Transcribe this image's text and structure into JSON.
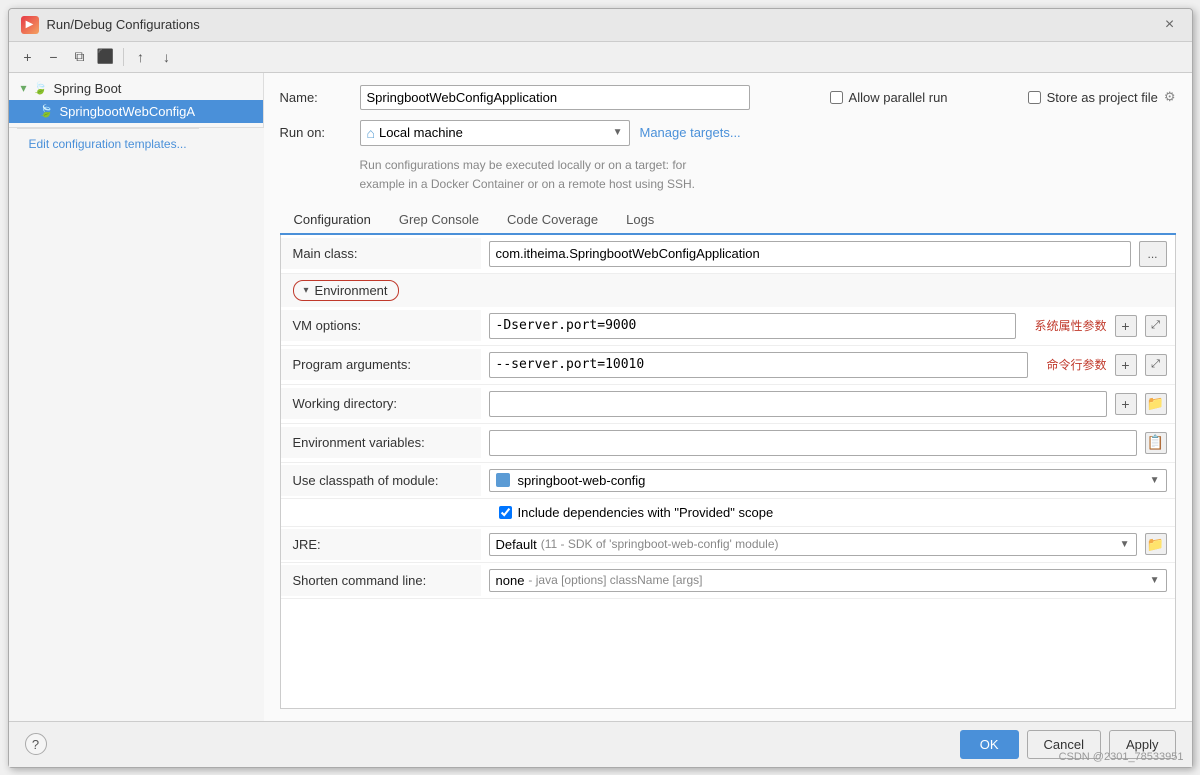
{
  "dialog": {
    "title": "Run/Debug Configurations",
    "close_label": "×"
  },
  "toolbar": {
    "add_label": "+",
    "remove_label": "−",
    "copy_label": "⧉",
    "move_up_label": "↑",
    "move_down_label": "↓"
  },
  "sidebar": {
    "spring_boot_label": "Spring Boot",
    "active_item_label": "SpringbootWebConfigA",
    "edit_templates_label": "Edit configuration templates..."
  },
  "header": {
    "name_label": "Name:",
    "name_value": "SpringbootWebConfigApplication",
    "allow_parallel_label": "Allow parallel run",
    "store_as_project_label": "Store as project file",
    "run_on_label": "Run on:",
    "local_machine_label": "Local machine",
    "manage_targets_label": "Manage targets...",
    "hint_line1": "Run configurations may be executed locally or on a target: for",
    "hint_line2": "example in a Docker Container or on a remote host using SSH."
  },
  "tabs": {
    "configuration_label": "Configuration",
    "grep_console_label": "Grep Console",
    "code_coverage_label": "Code Coverage",
    "logs_label": "Logs"
  },
  "config": {
    "main_class_label": "Main class:",
    "main_class_value": "com.itheima.SpringbootWebConfigApplication",
    "ellipsis_label": "...",
    "environment_section_label": "Environment",
    "vm_options_label": "VM options:",
    "vm_options_value": "-Dserver.port=9000",
    "vm_options_annotation": "系统属性参数",
    "program_args_label": "Program arguments:",
    "program_args_value": "--server.port=10010",
    "program_args_annotation": "命令行参数",
    "working_dir_label": "Working directory:",
    "env_vars_label": "Environment variables:",
    "classpath_label": "Use classpath of module:",
    "classpath_value": "springboot-web-config",
    "include_deps_label": "Include dependencies with \"Provided\" scope",
    "jre_label": "JRE:",
    "jre_default": "Default",
    "jre_detail": "(11 - SDK of 'springboot-web-config' module)",
    "shorten_label": "Shorten command line:",
    "shorten_none": "none",
    "shorten_detail": "- java [options] className [args]"
  },
  "footer": {
    "help_label": "?",
    "ok_label": "OK",
    "cancel_label": "Cancel",
    "apply_label": "Apply"
  },
  "watermark": {
    "text": "CSDN @2301_78533951"
  }
}
